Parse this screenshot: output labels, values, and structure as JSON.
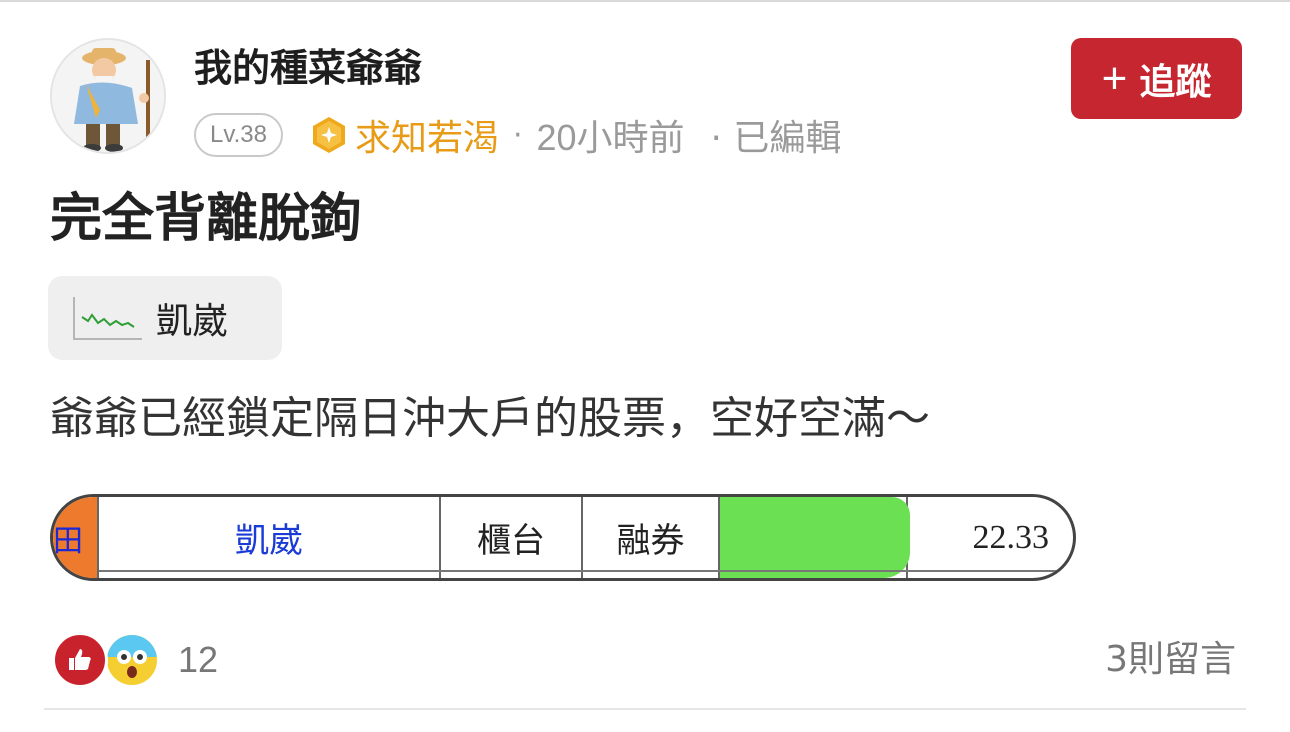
{
  "post": {
    "author": "我的種菜爺爺",
    "level": "Lv.38",
    "badge": "求知若渴",
    "separator": "·",
    "time": "20小時前",
    "edited": "· 已編輯",
    "follow_label": "追蹤",
    "title": "完全背離脫鉤",
    "stock_tag": "凱崴",
    "body": "爺爺已經鎖定隔日沖大戶的股票，空好空滿～"
  },
  "trade_row": {
    "flag": "田",
    "name": "凱崴",
    "market": "櫃台",
    "type": "融券",
    "price": "22.33"
  },
  "footer": {
    "reaction_count": "12",
    "comments": "3則留言"
  },
  "colors": {
    "follow_bg": "#c62630",
    "badge": "#e89b17",
    "redacted": "#6be052",
    "name_link": "#1a3bd6"
  },
  "icons": [
    "avatar-farmer",
    "gold-badge-icon",
    "stock-sparkline-icon",
    "thumbs-up-icon",
    "shocked-face-icon"
  ]
}
